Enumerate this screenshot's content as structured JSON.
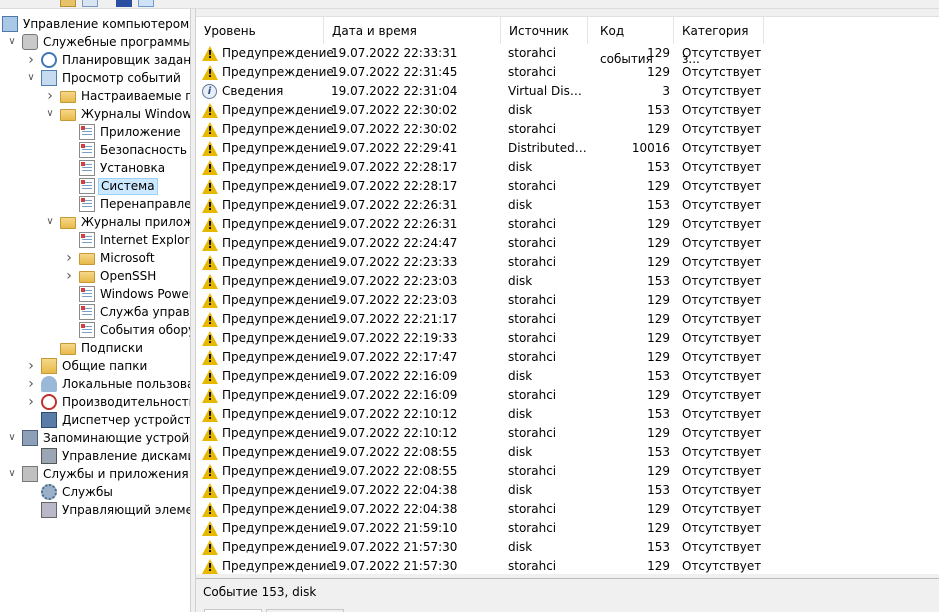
{
  "tree": {
    "items": [
      {
        "label": "Управление компьютером (л",
        "icon": "computer-management-icon",
        "expander": ""
      },
      {
        "label": "Служебные программы",
        "icon": "system-tools-icon",
        "expander": "expanded"
      },
      {
        "label": "Планировщик заданий",
        "icon": "task-scheduler-icon",
        "expander": "collapsed"
      },
      {
        "label": "Просмотр событий",
        "icon": "event-viewer-icon",
        "expander": "expanded"
      },
      {
        "label": "Настраиваемые пр",
        "icon": "folder-icon",
        "expander": "collapsed"
      },
      {
        "label": "Журналы Windows",
        "icon": "folder-icon",
        "expander": "expanded"
      },
      {
        "label": "Приложение",
        "icon": "log-icon",
        "expander": ""
      },
      {
        "label": "Безопасность",
        "icon": "log-icon",
        "expander": ""
      },
      {
        "label": "Установка",
        "icon": "log-icon",
        "expander": ""
      },
      {
        "label": "Система",
        "icon": "log-icon",
        "expander": "",
        "selected": true
      },
      {
        "label": "Перенаправлен",
        "icon": "log-icon",
        "expander": ""
      },
      {
        "label": "Журналы приложе",
        "icon": "folder-icon",
        "expander": "expanded"
      },
      {
        "label": "Internet Explorer",
        "icon": "log-icon",
        "expander": ""
      },
      {
        "label": "Microsoft",
        "icon": "folder-icon",
        "expander": "collapsed"
      },
      {
        "label": "OpenSSH",
        "icon": "folder-icon",
        "expander": "collapsed"
      },
      {
        "label": "Windows Power",
        "icon": "log-icon",
        "expander": ""
      },
      {
        "label": "Служба управл",
        "icon": "log-icon",
        "expander": ""
      },
      {
        "label": "События обору",
        "icon": "log-icon",
        "expander": ""
      },
      {
        "label": "Подписки",
        "icon": "subscriptions-icon",
        "expander": ""
      },
      {
        "label": "Общие папки",
        "icon": "shared-folders-icon",
        "expander": "collapsed"
      },
      {
        "label": "Локальные пользовате",
        "icon": "local-users-icon",
        "expander": "collapsed"
      },
      {
        "label": "Производительность",
        "icon": "performance-icon",
        "expander": "collapsed"
      },
      {
        "label": "Диспетчер устройств",
        "icon": "device-manager-icon",
        "expander": ""
      },
      {
        "label": "Запоминающие устройст",
        "icon": "storage-icon",
        "expander": "expanded"
      },
      {
        "label": "Управление дисками",
        "icon": "disk-management-icon",
        "expander": ""
      },
      {
        "label": "Службы и приложения",
        "icon": "services-apps-icon",
        "expander": "expanded"
      },
      {
        "label": "Службы",
        "icon": "services-gear-icon",
        "expander": ""
      },
      {
        "label": "Управляющий элемен",
        "icon": "wmi-control-icon",
        "expander": ""
      }
    ]
  },
  "events": {
    "columns": [
      "Уровень",
      "Дата и время",
      "Источник",
      "Код события",
      "Категория з..."
    ],
    "rows": [
      {
        "level": "Предупреждение",
        "type": "warning",
        "date": "19.07.2022 22:33:31",
        "source": "storahci",
        "id": "129",
        "category": "Отсутствует"
      },
      {
        "level": "Предупреждение",
        "type": "warning",
        "date": "19.07.2022 22:31:45",
        "source": "storahci",
        "id": "129",
        "category": "Отсутствует"
      },
      {
        "level": "Сведения",
        "type": "info",
        "date": "19.07.2022 22:31:04",
        "source": "Virtual Disk ...",
        "id": "3",
        "category": "Отсутствует"
      },
      {
        "level": "Предупреждение",
        "type": "warning",
        "date": "19.07.2022 22:30:02",
        "source": "disk",
        "id": "153",
        "category": "Отсутствует"
      },
      {
        "level": "Предупреждение",
        "type": "warning",
        "date": "19.07.2022 22:30:02",
        "source": "storahci",
        "id": "129",
        "category": "Отсутствует"
      },
      {
        "level": "Предупреждение",
        "type": "warning",
        "date": "19.07.2022 22:29:41",
        "source": "DistributedC...",
        "id": "10016",
        "category": "Отсутствует"
      },
      {
        "level": "Предупреждение",
        "type": "warning",
        "date": "19.07.2022 22:28:17",
        "source": "disk",
        "id": "153",
        "category": "Отсутствует"
      },
      {
        "level": "Предупреждение",
        "type": "warning",
        "date": "19.07.2022 22:28:17",
        "source": "storahci",
        "id": "129",
        "category": "Отсутствует"
      },
      {
        "level": "Предупреждение",
        "type": "warning",
        "date": "19.07.2022 22:26:31",
        "source": "disk",
        "id": "153",
        "category": "Отсутствует"
      },
      {
        "level": "Предупреждение",
        "type": "warning",
        "date": "19.07.2022 22:26:31",
        "source": "storahci",
        "id": "129",
        "category": "Отсутствует"
      },
      {
        "level": "Предупреждение",
        "type": "warning",
        "date": "19.07.2022 22:24:47",
        "source": "storahci",
        "id": "129",
        "category": "Отсутствует"
      },
      {
        "level": "Предупреждение",
        "type": "warning",
        "date": "19.07.2022 22:23:33",
        "source": "storahci",
        "id": "129",
        "category": "Отсутствует"
      },
      {
        "level": "Предупреждение",
        "type": "warning",
        "date": "19.07.2022 22:23:03",
        "source": "disk",
        "id": "153",
        "category": "Отсутствует"
      },
      {
        "level": "Предупреждение",
        "type": "warning",
        "date": "19.07.2022 22:23:03",
        "source": "storahci",
        "id": "129",
        "category": "Отсутствует"
      },
      {
        "level": "Предупреждение",
        "type": "warning",
        "date": "19.07.2022 22:21:17",
        "source": "storahci",
        "id": "129",
        "category": "Отсутствует"
      },
      {
        "level": "Предупреждение",
        "type": "warning",
        "date": "19.07.2022 22:19:33",
        "source": "storahci",
        "id": "129",
        "category": "Отсутствует"
      },
      {
        "level": "Предупреждение",
        "type": "warning",
        "date": "19.07.2022 22:17:47",
        "source": "storahci",
        "id": "129",
        "category": "Отсутствует"
      },
      {
        "level": "Предупреждение",
        "type": "warning",
        "date": "19.07.2022 22:16:09",
        "source": "disk",
        "id": "153",
        "category": "Отсутствует"
      },
      {
        "level": "Предупреждение",
        "type": "warning",
        "date": "19.07.2022 22:16:09",
        "source": "storahci",
        "id": "129",
        "category": "Отсутствует"
      },
      {
        "level": "Предупреждение",
        "type": "warning",
        "date": "19.07.2022 22:10:12",
        "source": "disk",
        "id": "153",
        "category": "Отсутствует"
      },
      {
        "level": "Предупреждение",
        "type": "warning",
        "date": "19.07.2022 22:10:12",
        "source": "storahci",
        "id": "129",
        "category": "Отсутствует"
      },
      {
        "level": "Предупреждение",
        "type": "warning",
        "date": "19.07.2022 22:08:55",
        "source": "disk",
        "id": "153",
        "category": "Отсутствует"
      },
      {
        "level": "Предупреждение",
        "type": "warning",
        "date": "19.07.2022 22:08:55",
        "source": "storahci",
        "id": "129",
        "category": "Отсутствует"
      },
      {
        "level": "Предупреждение",
        "type": "warning",
        "date": "19.07.2022 22:04:38",
        "source": "disk",
        "id": "153",
        "category": "Отсутствует"
      },
      {
        "level": "Предупреждение",
        "type": "warning",
        "date": "19.07.2022 22:04:38",
        "source": "storahci",
        "id": "129",
        "category": "Отсутствует"
      },
      {
        "level": "Предупреждение",
        "type": "warning",
        "date": "19.07.2022 21:59:10",
        "source": "storahci",
        "id": "129",
        "category": "Отсутствует"
      },
      {
        "level": "Предупреждение",
        "type": "warning",
        "date": "19.07.2022 21:57:30",
        "source": "disk",
        "id": "153",
        "category": "Отсутствует"
      },
      {
        "level": "Предупреждение",
        "type": "warning",
        "date": "19.07.2022 21:57:30",
        "source": "storahci",
        "id": "129",
        "category": "Отсутствует"
      }
    ]
  },
  "detail": {
    "title": "Событие 153, disk"
  },
  "colors": {
    "warning": "#e6b800",
    "selection": "#cce8ff",
    "selection_border": "#99d1ff"
  }
}
